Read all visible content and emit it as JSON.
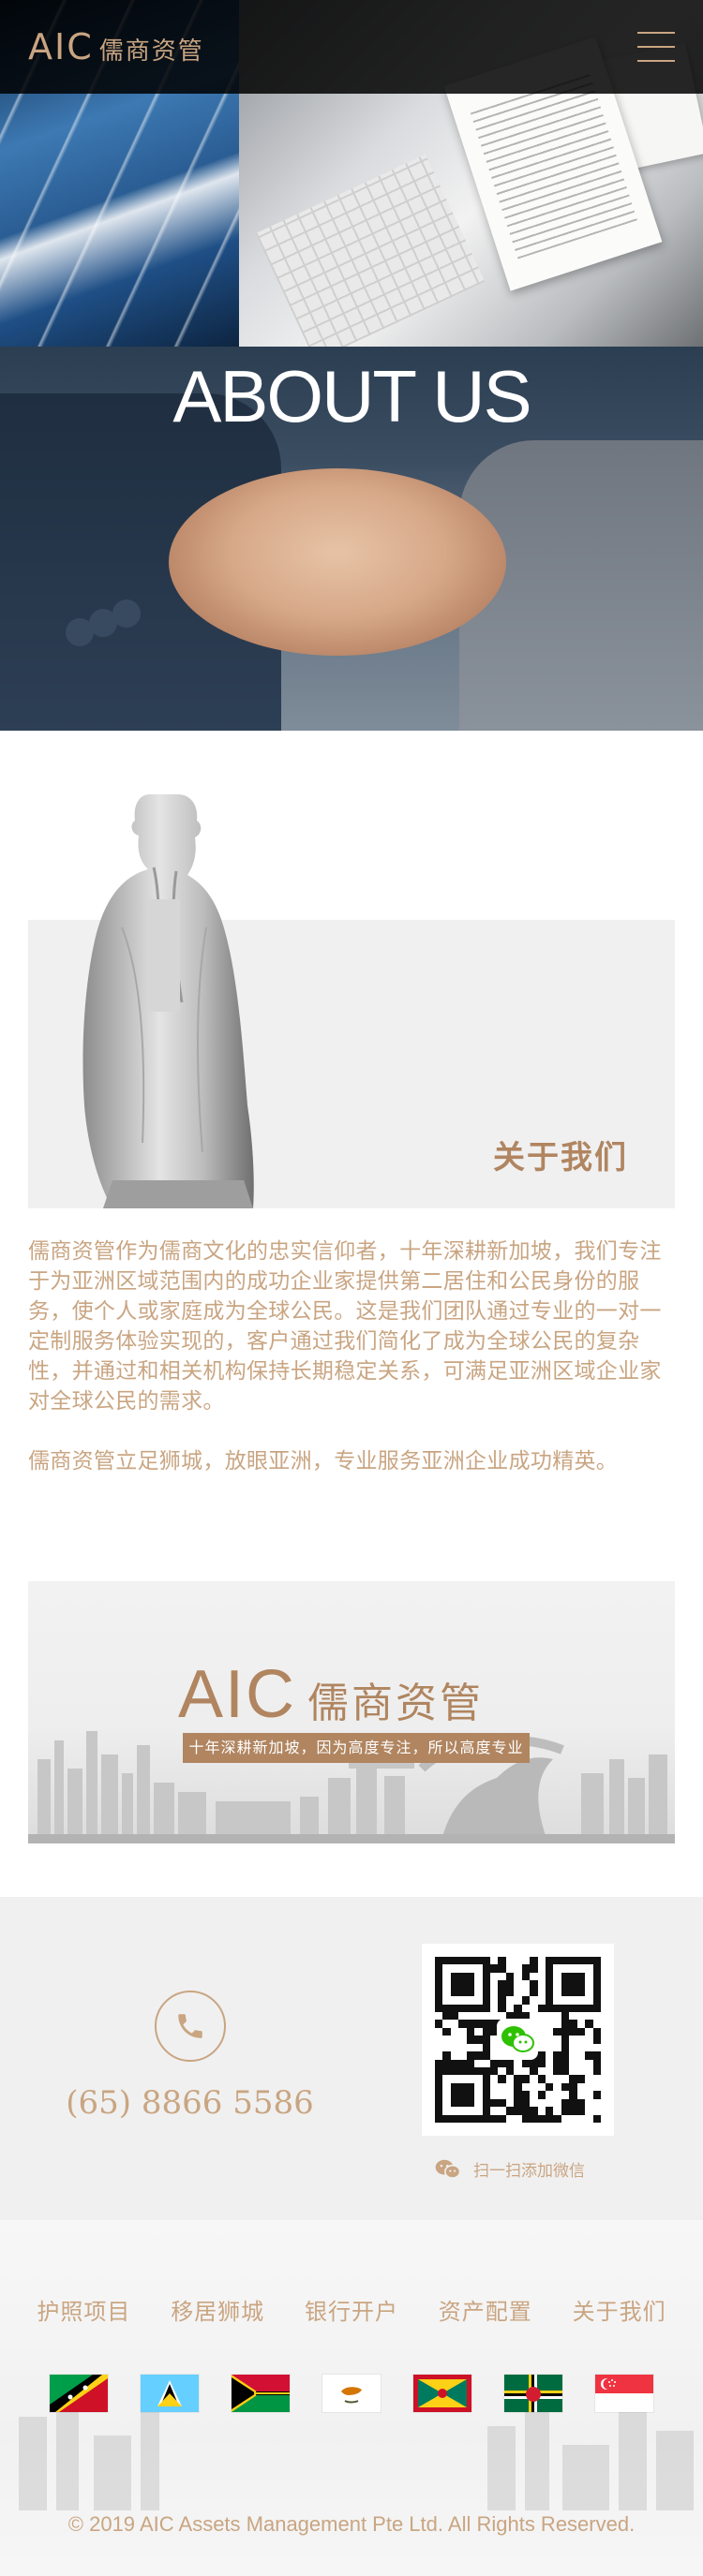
{
  "header": {
    "logo_mark": "AIC",
    "logo_cn": "儒商资管",
    "menu_icon": "hamburger-menu-icon"
  },
  "hero": {
    "title": "ABOUT US"
  },
  "about": {
    "heading": "关于我们",
    "paragraph1": "儒商资管作为儒商文化的忠实信仰者，十年深耕新加坡，我们专注于为亚洲区域范围内的成功企业家提供第二居住和公民身份的服务，使个人或家庭成为全球公民。这是我们团队通过专业的一对一定制服务体验实现的，客户通过我们简化了成为全球公民的复杂性，并通过和相关机构保持长期稳定关系，可满足亚洲区域企业家对全球公民的需求。",
    "paragraph2": "儒商资管立足狮城，放眼亚洲，专业服务亚洲企业成功精英。"
  },
  "banner": {
    "logo_mark": "AIC",
    "logo_cn": "儒商资管",
    "tagline": "十年深耕新加坡，因为高度专注，所以高度专业"
  },
  "contact": {
    "phone_icon": "phone-icon",
    "phone": "(65) 8866 5586",
    "wechat_icon": "wechat-icon",
    "wechat_label": "扫一扫添加微信"
  },
  "footer": {
    "nav": [
      "护照项目",
      "移居狮城",
      "银行开户",
      "资产配置",
      "关于我们"
    ],
    "flags": [
      "saint-kitts-and-nevis",
      "saint-lucia",
      "vanuatu",
      "cyprus",
      "grenada",
      "dominica",
      "singapore"
    ],
    "copyright": "© 2019 AIC Assets Management Pte Ltd. All Rights Reserved."
  },
  "colors": {
    "accent": "#c9a582",
    "accent_dark": "#b08560",
    "header_bg": "#000000",
    "section_bg": "#f0f0f0"
  }
}
